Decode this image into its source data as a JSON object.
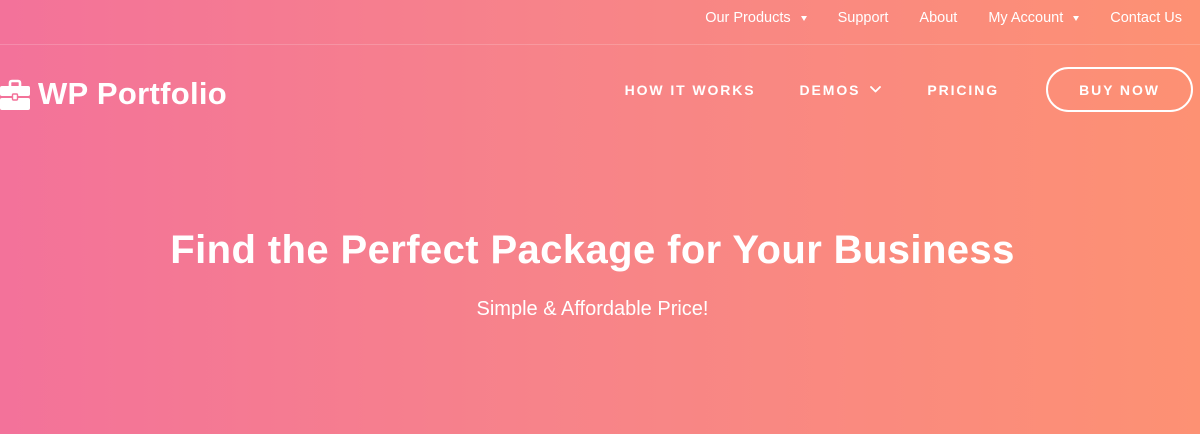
{
  "topbar": {
    "items": [
      {
        "label": "Our Products",
        "has_dropdown": true
      },
      {
        "label": "Support",
        "has_dropdown": false
      },
      {
        "label": "About",
        "has_dropdown": false
      },
      {
        "label": "My Account",
        "has_dropdown": true
      },
      {
        "label": "Contact Us",
        "has_dropdown": false
      }
    ]
  },
  "header": {
    "logo_text": "WP Portfolio",
    "logo_icon": "briefcase-icon",
    "nav": [
      {
        "label": "HOW IT WORKS"
      },
      {
        "label": "DEMOS",
        "icon": "chevron-down-icon"
      },
      {
        "label": "PRICING"
      }
    ],
    "cta_label": "BUY NOW"
  },
  "hero": {
    "title": "Find the Perfect Package for Your Business",
    "subtitle": "Simple & Affordable Price!"
  },
  "colors": {
    "gradient_start": "#f3729a",
    "gradient_end": "#fd9173",
    "text": "#ffffff"
  }
}
